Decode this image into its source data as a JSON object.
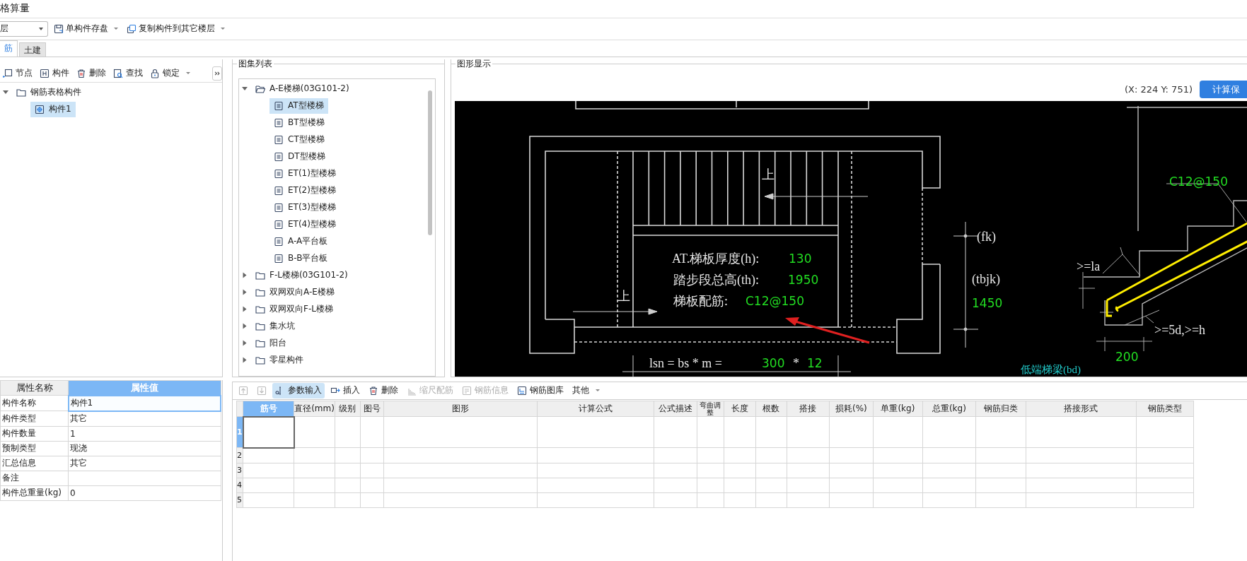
{
  "window": {
    "title": "格算量"
  },
  "toolbar": {
    "floor_combo": {
      "value": "层"
    },
    "buttons": [
      {
        "label": "单构件存盘",
        "dropdown": true
      },
      {
        "label": "复制构件到其它楼层",
        "dropdown": true
      }
    ]
  },
  "tabs": [
    {
      "label": "筋",
      "selected": true
    },
    {
      "label": "土建",
      "selected": false
    }
  ],
  "component_panel": {
    "toolbar": [
      {
        "label": "节点",
        "dropdown": false
      },
      {
        "label": "构件",
        "dropdown": false
      },
      {
        "label": "删除",
        "dropdown": false
      },
      {
        "label": "查找",
        "dropdown": false
      },
      {
        "label": "锁定",
        "dropdown": true
      }
    ],
    "tree": [
      {
        "label": "钢筋表格构件",
        "expanded": true,
        "children": [
          {
            "label": "构件1",
            "selected": true
          }
        ]
      }
    ]
  },
  "properties": {
    "columns": [
      "属性名称",
      "属性值"
    ],
    "rows": [
      {
        "name": "构件名称",
        "value": "构件1",
        "selected": true
      },
      {
        "name": "构件类型",
        "value": "其它",
        "selected": false
      },
      {
        "name": "构件数量",
        "value": "1",
        "selected": false
      },
      {
        "name": "预制类型",
        "value": "现浇",
        "selected": false
      },
      {
        "name": "汇总信息",
        "value": "其它",
        "selected": false
      },
      {
        "name": "备注",
        "value": "",
        "selected": false
      },
      {
        "name": "构件总重量(kg)",
        "value": "0",
        "selected": false
      }
    ]
  },
  "atlas_list": {
    "title": "图集列表",
    "tree": [
      {
        "label": "A-E楼梯(03G101-2)",
        "expanded": true,
        "children": [
          {
            "label": "AT型楼梯",
            "selected": true
          },
          {
            "label": "BT型楼梯",
            "selected": false
          },
          {
            "label": "CT型楼梯",
            "selected": false
          },
          {
            "label": "DT型楼梯",
            "selected": false
          },
          {
            "label": "ET(1)型楼梯",
            "selected": false
          },
          {
            "label": "ET(2)型楼梯",
            "selected": false
          },
          {
            "label": "ET(3)型楼梯",
            "selected": false
          },
          {
            "label": "ET(4)型楼梯",
            "selected": false
          },
          {
            "label": "A-A平台板",
            "selected": false
          },
          {
            "label": "B-B平台板",
            "selected": false
          }
        ]
      },
      {
        "label": "F-L楼梯(03G101-2)",
        "expanded": false
      },
      {
        "label": "双网双向A-E楼梯",
        "expanded": false
      },
      {
        "label": "双网双向F-L楼梯",
        "expanded": false
      },
      {
        "label": "集水坑",
        "expanded": false
      },
      {
        "label": "阳台",
        "expanded": false
      },
      {
        "label": "零星构件",
        "expanded": false
      }
    ]
  },
  "graphic": {
    "title": "图形显示",
    "coordinates": "(X: 224 Y: 751)",
    "save_button": "计算保",
    "drawing_texts": [
      {
        "text": "AT.梯板厚度(h):",
        "kind": "label"
      },
      {
        "text": "130",
        "kind": "value"
      },
      {
        "text": "踏步段总高(th):",
        "kind": "label"
      },
      {
        "text": "1950",
        "kind": "value"
      },
      {
        "text": "梯板配筋:",
        "kind": "label"
      },
      {
        "text": "C12@150",
        "kind": "value"
      },
      {
        "text": "上",
        "kind": "label"
      },
      {
        "text": "上",
        "kind": "label"
      },
      {
        "text": "lsn = bs * m =",
        "kind": "label"
      },
      {
        "text": "300",
        "kind": "value"
      },
      {
        "text": "*",
        "kind": "label"
      },
      {
        "text": "12",
        "kind": "value"
      },
      {
        "text": "(fk)",
        "kind": "label"
      },
      {
        "text": "(tbjk)",
        "kind": "label"
      },
      {
        "text": "1450",
        "kind": "value"
      },
      {
        "text": "C12@150",
        "kind": "value"
      },
      {
        "text": ">=la",
        "kind": "label"
      },
      {
        "text": ">=5d,>=h",
        "kind": "label"
      },
      {
        "text": "200",
        "kind": "value"
      },
      {
        "text": "低端梯梁(bd)",
        "kind": "note"
      }
    ]
  },
  "rebar_table": {
    "toolbar": [
      {
        "kind": "icon",
        "disabled": true,
        "selected": false,
        "dropdown": false
      },
      {
        "kind": "icon",
        "disabled": true,
        "selected": false,
        "dropdown": false
      },
      {
        "kind": "button",
        "label": "参数输入",
        "disabled": false,
        "selected": true,
        "dropdown": false
      },
      {
        "kind": "button",
        "label": "插入",
        "disabled": false,
        "selected": false,
        "dropdown": false
      },
      {
        "kind": "button",
        "label": "删除",
        "disabled": false,
        "selected": false,
        "dropdown": false
      },
      {
        "kind": "button",
        "label": "缩尺配筋",
        "disabled": true,
        "selected": false,
        "dropdown": false
      },
      {
        "kind": "button",
        "label": "钢筋信息",
        "disabled": true,
        "selected": false,
        "dropdown": false
      },
      {
        "kind": "button",
        "label": "钢筋图库",
        "disabled": false,
        "selected": false,
        "dropdown": false
      },
      {
        "kind": "button",
        "label": "其他",
        "disabled": false,
        "selected": false,
        "dropdown": true
      }
    ],
    "columns": [
      "筋号",
      "直径(mm)",
      "级别",
      "图号",
      "图形",
      "计算公式",
      "公式描述",
      "弯曲调整",
      "长度",
      "根数",
      "搭接",
      "损耗(%)",
      "单重(kg)",
      "总重(kg)",
      "钢筋归类",
      "搭接形式",
      "钢筋类型"
    ],
    "rows": [
      {
        "number": "1",
        "selected": true
      },
      {
        "number": "2",
        "selected": false
      },
      {
        "number": "3",
        "selected": false
      },
      {
        "number": "4",
        "selected": false
      },
      {
        "number": "5",
        "selected": false
      }
    ]
  }
}
